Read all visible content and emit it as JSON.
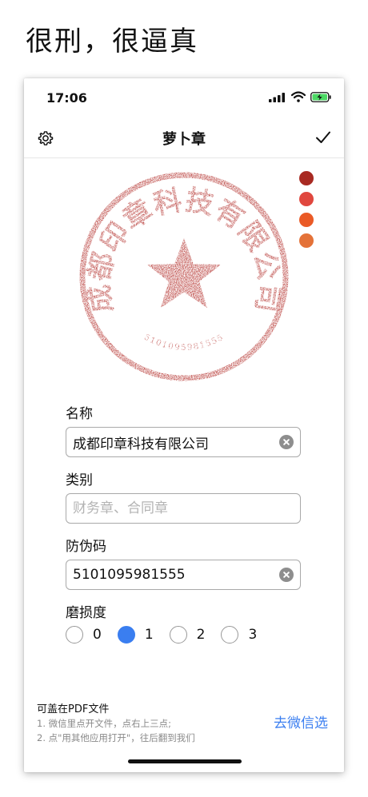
{
  "headline": "很刑，很逼真",
  "status_bar": {
    "time": "17:06"
  },
  "navbar": {
    "title": "萝卜章"
  },
  "colors": [
    "#a82a22",
    "#e0473e",
    "#ea5a26",
    "#e47238"
  ],
  "stamp": {
    "company_arc": "成都印章科技有限公司",
    "serial_arc": "5101095981555",
    "color": "#b12a26"
  },
  "form": {
    "name_label": "名称",
    "name_value": "成都印章科技有限公司",
    "category_label": "类别",
    "category_placeholder": "财务章、合同章",
    "code_label": "防伪码",
    "code_value": "5101095981555",
    "wear_label": "磨损度",
    "wear_options": [
      "0",
      "1",
      "2",
      "3"
    ],
    "wear_selected": "1"
  },
  "footer": {
    "title": "可盖在PDF文件",
    "step1": "1. 微信里点开文件，点右上三点;",
    "step2": "2. 点\"用其他应用打开\"，往后翻到我们",
    "link": "去微信选"
  }
}
